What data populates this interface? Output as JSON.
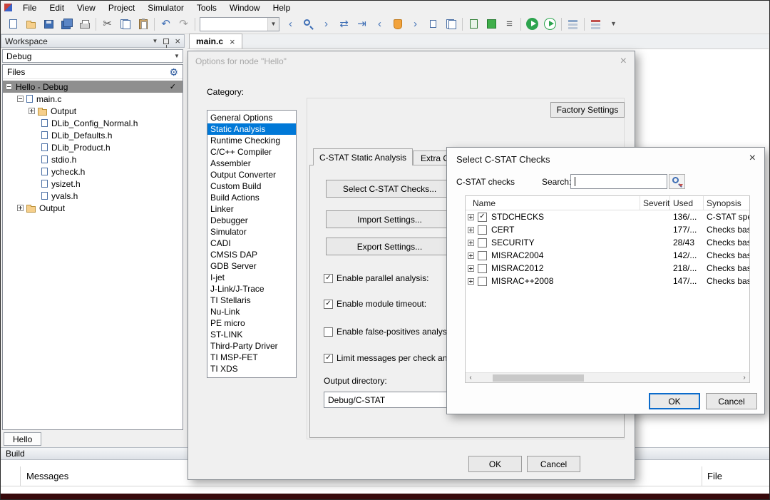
{
  "menu": {
    "items": [
      "File",
      "Edit",
      "View",
      "Project",
      "Simulator",
      "Tools",
      "Window",
      "Help"
    ]
  },
  "toolbar": {
    "find_combo_value": "",
    "icon_names": [
      "new-document-icon",
      "open-file-icon",
      "save-icon",
      "save-all-icon",
      "print-icon",
      "cut-icon",
      "copy-icon",
      "paste-icon",
      "undo-icon",
      "redo-icon",
      "find-previous-icon",
      "find-icon",
      "find-next-icon",
      "replace-icon",
      "go-to-icon",
      "previous-bookmark-icon",
      "toggle-bookmark-icon",
      "next-bookmark-icon",
      "switch-header-source-icon",
      "next-document-icon",
      "compile-icon",
      "make-icon",
      "batch-build-icon",
      "download-and-debug-icon",
      "debug-without-downloading-icon",
      "breakpoints-icon",
      "call-stack-icon"
    ]
  },
  "workspace": {
    "title": "Workspace",
    "configuration": "Debug",
    "files_header": "Files",
    "bottom_tab": "Hello",
    "tree": [
      {
        "label": "Hello - Debug",
        "mark": "✓"
      },
      {
        "label": "main.c"
      },
      {
        "label": "Output"
      },
      {
        "label": "DLib_Config_Normal.h"
      },
      {
        "label": "DLib_Defaults.h"
      },
      {
        "label": "DLib_Product.h"
      },
      {
        "label": "stdio.h"
      },
      {
        "label": "ycheck.h"
      },
      {
        "label": "ysizet.h"
      },
      {
        "label": "yvals.h"
      },
      {
        "label": "Output"
      }
    ]
  },
  "editor": {
    "tab_label": "main.c"
  },
  "options_dialog": {
    "title": "Options for node \"Hello\"",
    "category_label": "Category:",
    "categories": [
      "General Options",
      "Static Analysis",
      "Runtime Checking",
      "C/C++ Compiler",
      "Assembler",
      "Output Converter",
      "Custom Build",
      "Build Actions",
      "Linker",
      "Debugger",
      "Simulator",
      "CADI",
      "CMSIS DAP",
      "GDB Server",
      "I-jet",
      "J-Link/J-Trace",
      "TI Stellaris",
      "Nu-Link",
      "PE micro",
      "ST-LINK",
      "Third-Party Driver",
      "TI MSP-FET",
      "TI XDS"
    ],
    "selected_category": "Static Analysis",
    "factory_settings_button": "Factory Settings",
    "tab_cstat": "C-STAT Static Analysis",
    "tab_extra": "Extra Opt",
    "select_checks_button": "Select C-STAT Checks...",
    "import_button": "Import Settings...",
    "export_button": "Export Settings...",
    "checkboxes": [
      {
        "label": "Enable parallel analysis:",
        "mark": "✓"
      },
      {
        "label": "Enable module timeout:",
        "mark": "✓"
      },
      {
        "label": "Enable false-positives analysis",
        "mark": ""
      },
      {
        "label": "Limit messages per check and",
        "mark": "✓"
      }
    ],
    "output_directory_label": "Output directory:",
    "output_directory_value": "Debug/C-STAT",
    "ok_button": "OK",
    "cancel_button": "Cancel"
  },
  "checks_dialog": {
    "title": "Select C-STAT Checks",
    "checks_label": "C-STAT checks",
    "search_label": "Search:",
    "search_value": "",
    "columns": {
      "name": "Name",
      "severity": "Severity",
      "used": "Used",
      "synopsis": "Synopsis"
    },
    "rows": [
      {
        "name": "STDCHECKS",
        "mark": "✓",
        "severity": "",
        "used": "136/...",
        "synopsis": "C-STAT spe"
      },
      {
        "name": "CERT",
        "mark": "",
        "severity": "",
        "used": "177/...",
        "synopsis": "Checks base"
      },
      {
        "name": "SECURITY",
        "mark": "",
        "severity": "",
        "used": "28/43",
        "synopsis": "Checks base"
      },
      {
        "name": "MISRAC2004",
        "mark": "",
        "severity": "",
        "used": "142/...",
        "synopsis": "Checks base"
      },
      {
        "name": "MISRAC2012",
        "mark": "",
        "severity": "",
        "used": "218/...",
        "synopsis": "Checks base"
      },
      {
        "name": "MISRAC++2008",
        "mark": "",
        "severity": "",
        "used": "147/...",
        "synopsis": "Checks base"
      }
    ],
    "ok_button": "OK",
    "cancel_button": "Cancel"
  },
  "build_panel": {
    "title": "Build",
    "messages_header": "Messages",
    "file_header": "File"
  }
}
